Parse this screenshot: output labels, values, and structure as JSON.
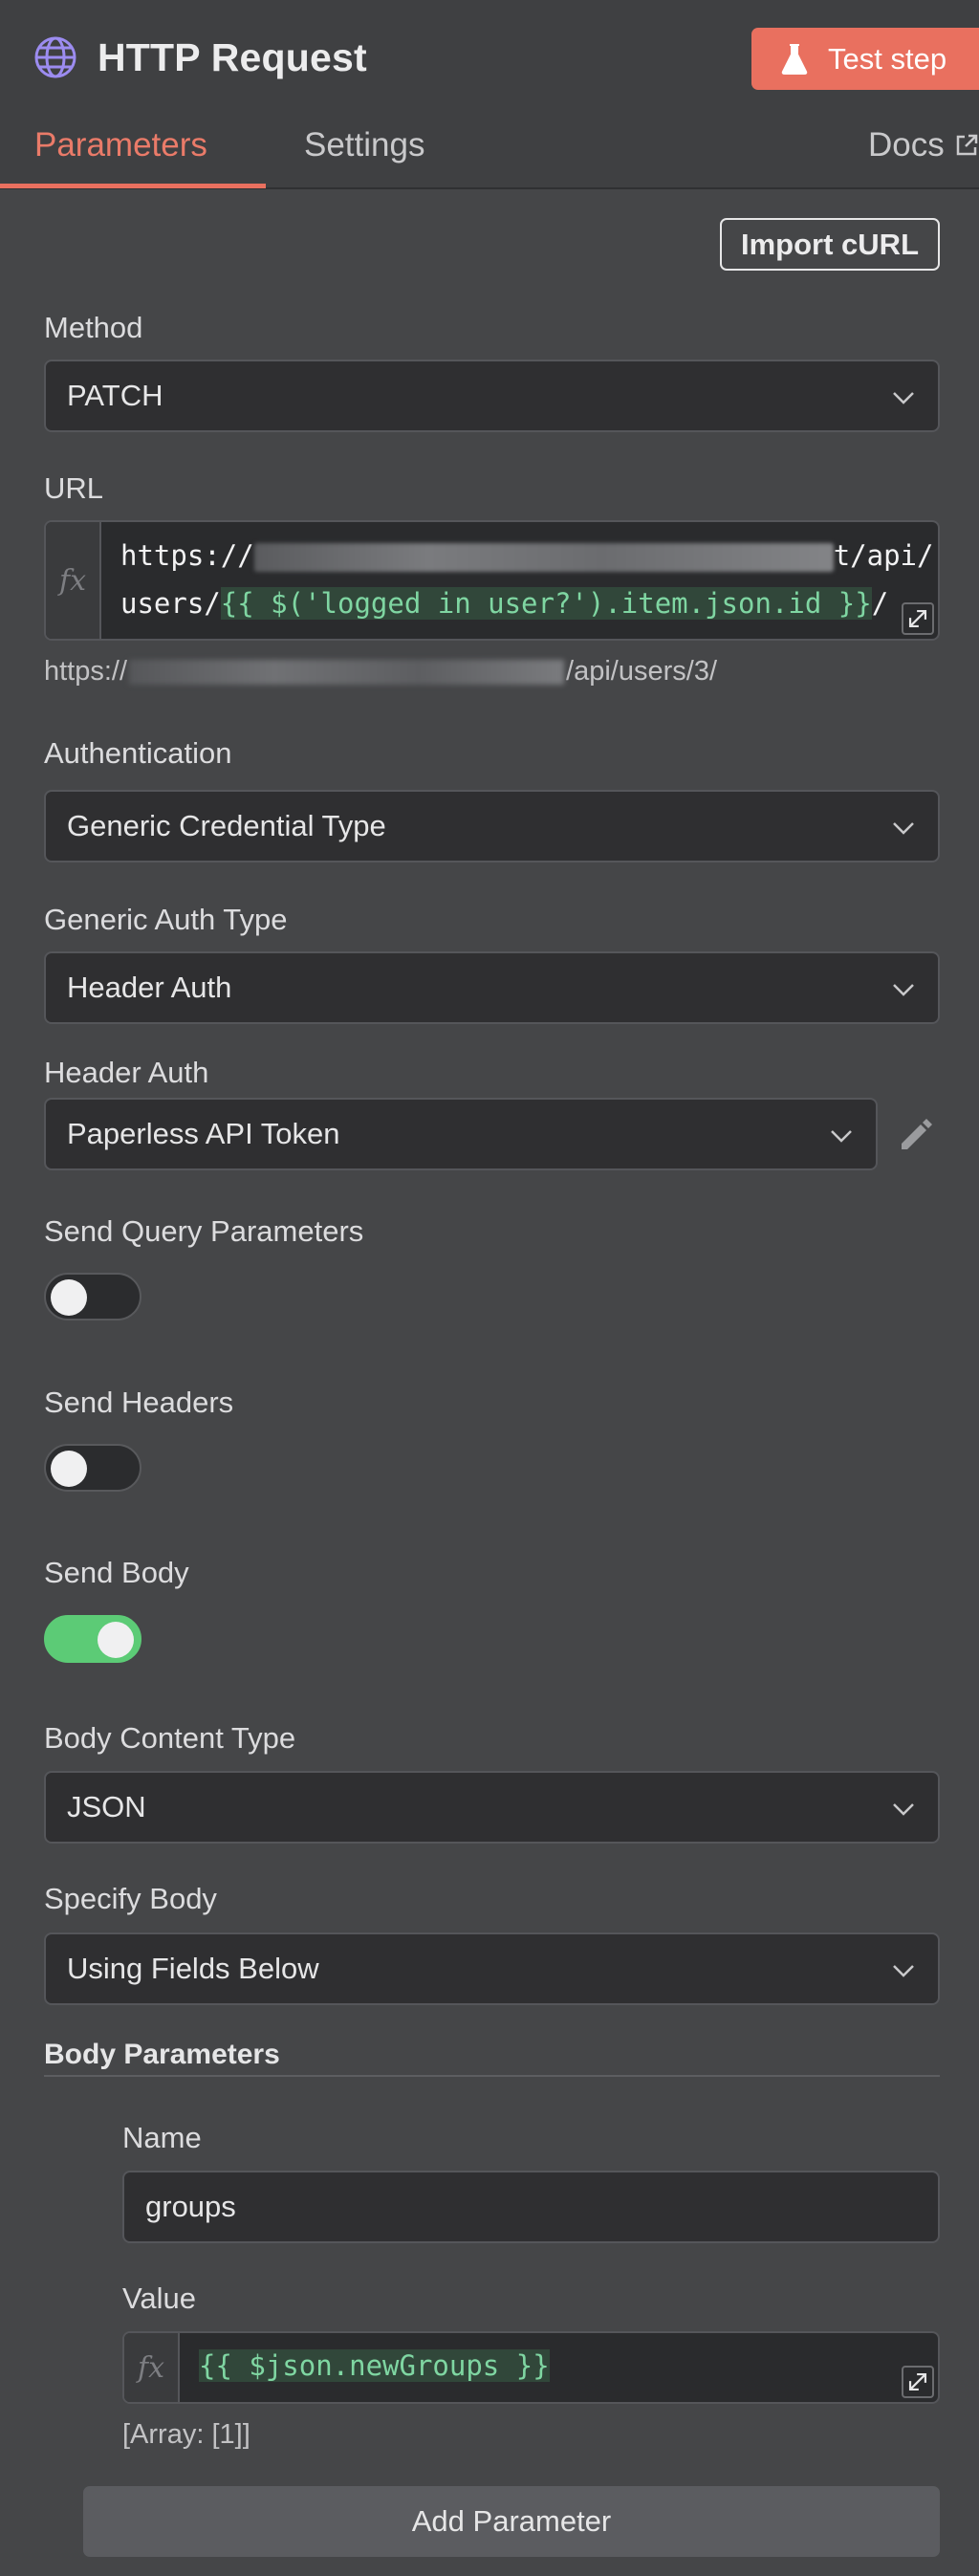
{
  "header": {
    "title": "HTTP Request",
    "test_button": "Test step",
    "tabs": [
      "Parameters",
      "Settings"
    ],
    "docs": "Docs",
    "icons": {
      "node": "globe-icon",
      "test": "flask-icon",
      "docs": "external-link-icon"
    }
  },
  "import_curl": "Import cURL",
  "method": {
    "label": "Method",
    "value": "PATCH"
  },
  "url": {
    "label": "URL",
    "line1_prefix": "https://",
    "line1_suffix": "t/api/",
    "line2_prefix": "users/",
    "line2_expr": "{{ $('logged in user?').item.json.id }}",
    "line2_tail": "/",
    "preview_prefix": "https://",
    "preview_suffix": "/api/users/3/"
  },
  "authentication": {
    "label": "Authentication",
    "value": "Generic Credential Type"
  },
  "generic_auth_type": {
    "label": "Generic Auth Type",
    "value": "Header Auth"
  },
  "header_auth": {
    "label": "Header Auth",
    "value": "Paperless API Token"
  },
  "send_query": {
    "label": "Send Query Parameters",
    "on": false
  },
  "send_headers": {
    "label": "Send Headers",
    "on": false
  },
  "send_body": {
    "label": "Send Body",
    "on": true
  },
  "body_content_type": {
    "label": "Body Content Type",
    "value": "JSON"
  },
  "specify_body": {
    "label": "Specify Body",
    "value": "Using Fields Below"
  },
  "body_parameters": {
    "title": "Body Parameters",
    "name_label": "Name",
    "name_value": "groups",
    "value_label": "Value",
    "value_expr": "{{ $json.newGroups }}",
    "value_hint": "[Array: [1]]",
    "add_button": "Add Parameter"
  },
  "colors": {
    "accent": "#e9705f",
    "toggle_on": "#5ccb76",
    "expression": "#7fd6a2"
  }
}
